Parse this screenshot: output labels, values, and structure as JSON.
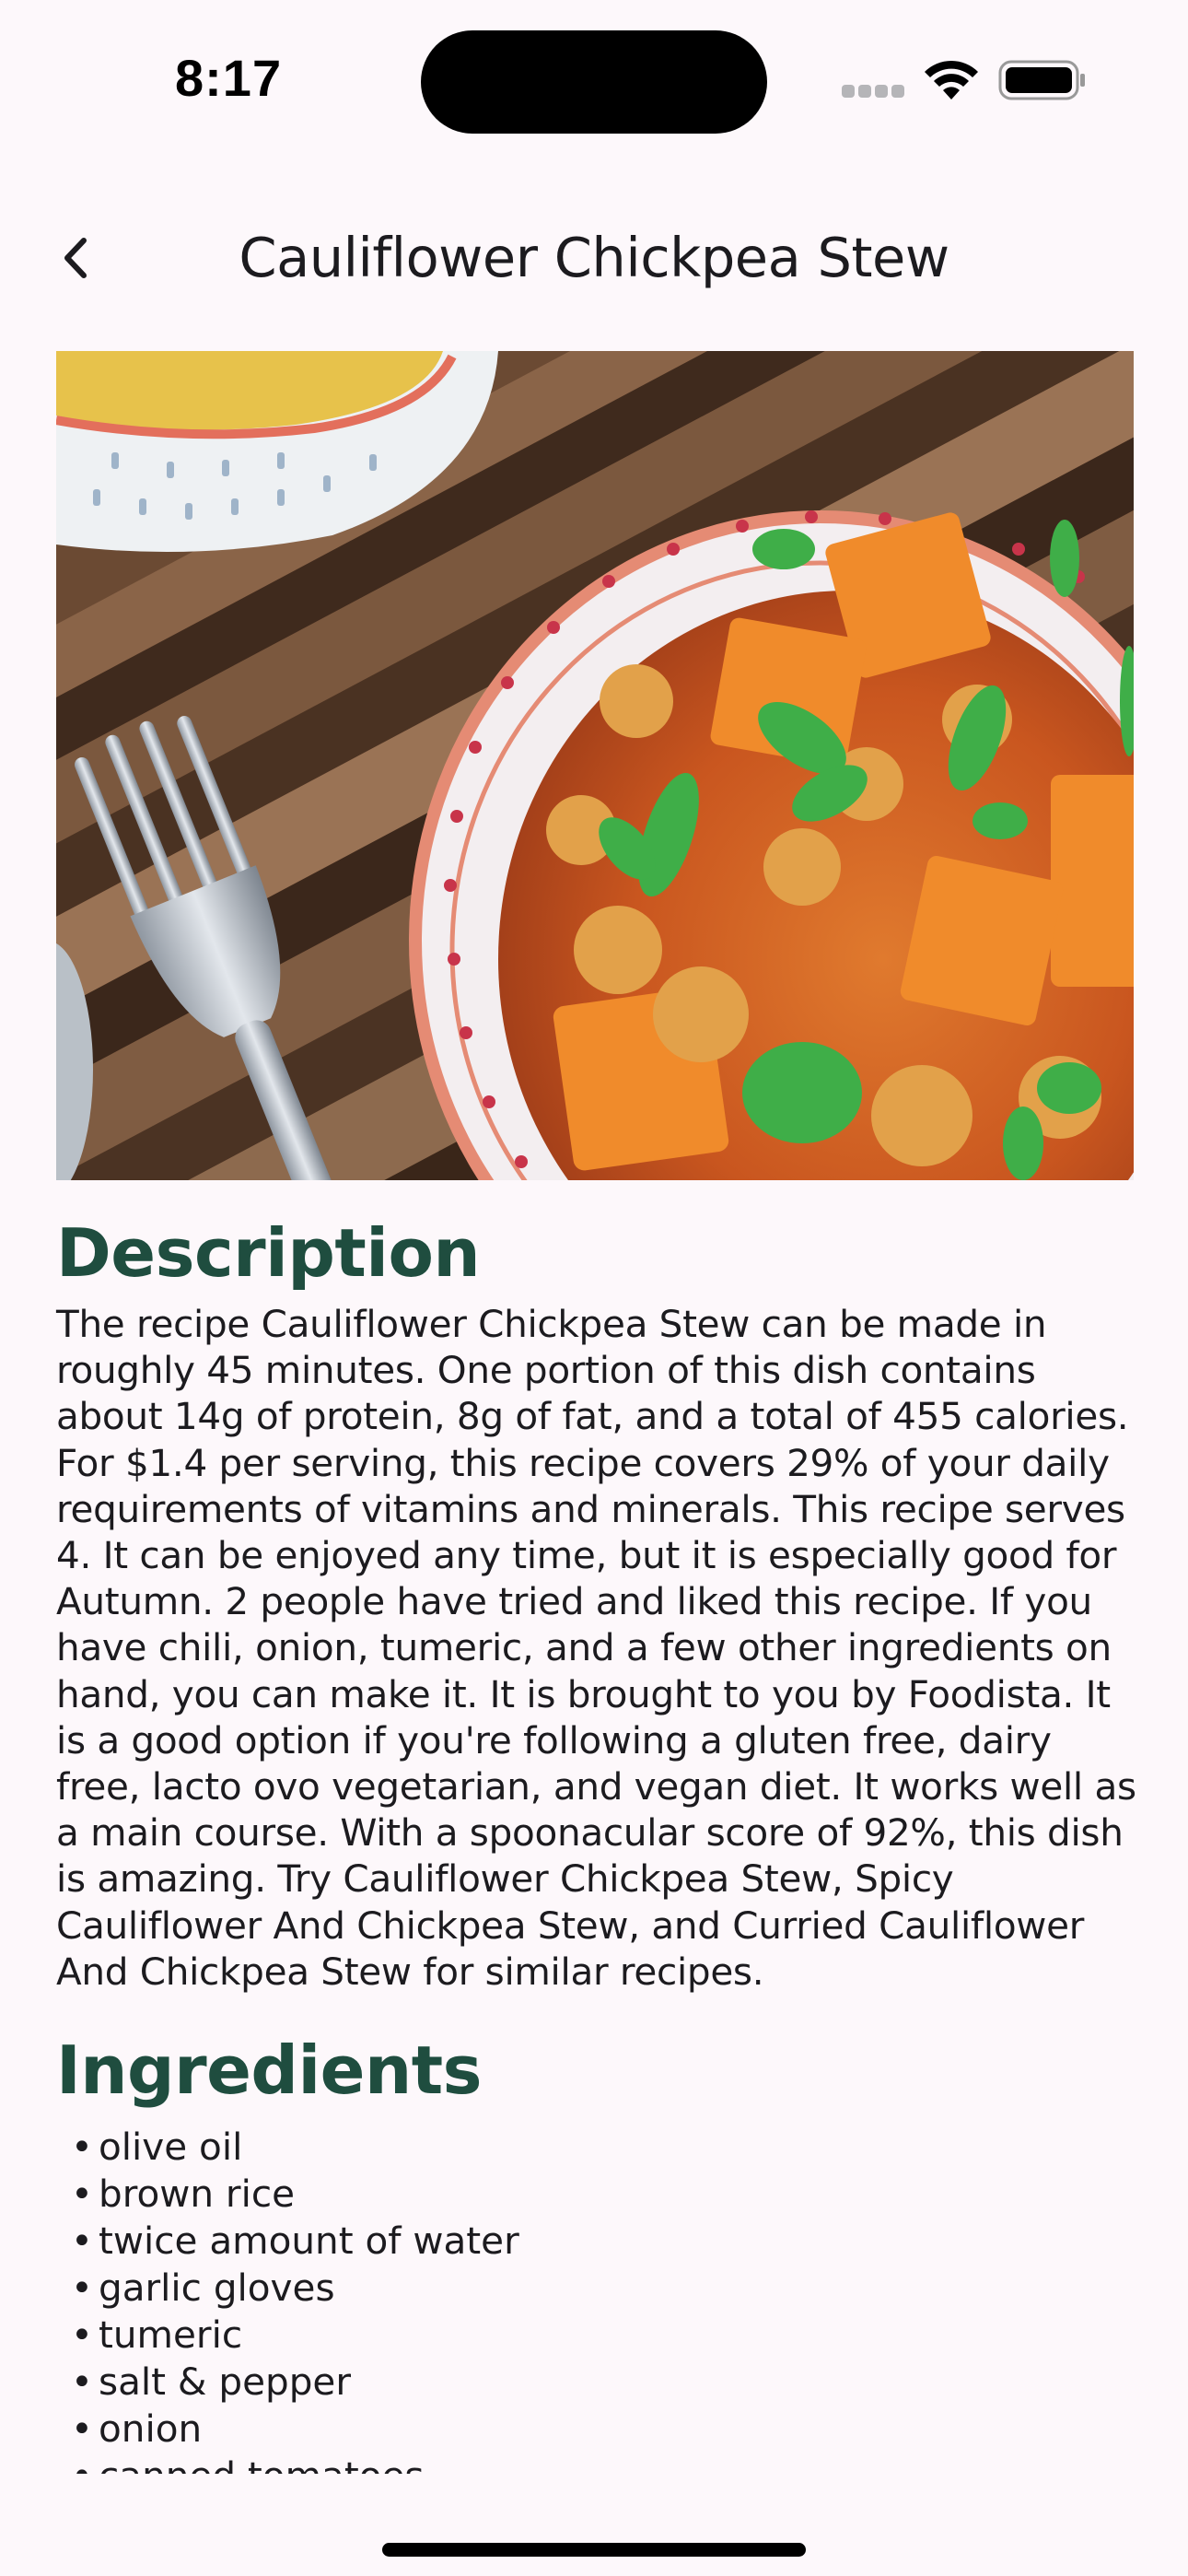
{
  "status_bar": {
    "time": "8:17",
    "signal_icon": "cellular-signal-icon",
    "wifi_icon": "wifi-icon",
    "battery_icon": "battery-icon"
  },
  "nav": {
    "back_icon": "chevron-left-icon",
    "title": "Cauliflower Chickpea Stew"
  },
  "hero_image": {
    "subject": "bowl of cauliflower chickpea stew with fork"
  },
  "description": {
    "heading": "Description",
    "text": "The recipe Cauliflower Chickpea Stew can be made in roughly 45 minutes. One portion of this dish contains about 14g of protein, 8g of fat, and a total of 455 calories. For $1.4 per serving, this recipe covers 29% of your daily requirements of vitamins and minerals. This recipe serves 4. It can be enjoyed any time, but it is especially good for Autumn. 2 people have tried and liked this recipe. If you have chili, onion, tumeric, and a few other ingredients on hand, you can make it. It is brought to you by Foodista. It is a good option if you're following a gluten free, dairy free, lacto ovo vegetarian, and vegan diet. It works well as a main course. With a spoonacular score of 92%, this dish is amazing. Try Cauliflower Chickpea Stew, Spicy Cauliflower And Chickpea Stew, and Curried Cauliflower And Chickpea Stew for similar recipes."
  },
  "ingredients": {
    "heading": "Ingredients",
    "bullet": "•",
    "items": [
      "olive oil",
      "brown rice",
      "twice amount of water",
      "garlic gloves",
      "tumeric",
      "salt & pepper",
      "onion",
      "canned tomatoes"
    ]
  },
  "colors": {
    "background": "#fdf8fb",
    "heading": "#1f4d3f",
    "text": "#1c1b1f"
  }
}
